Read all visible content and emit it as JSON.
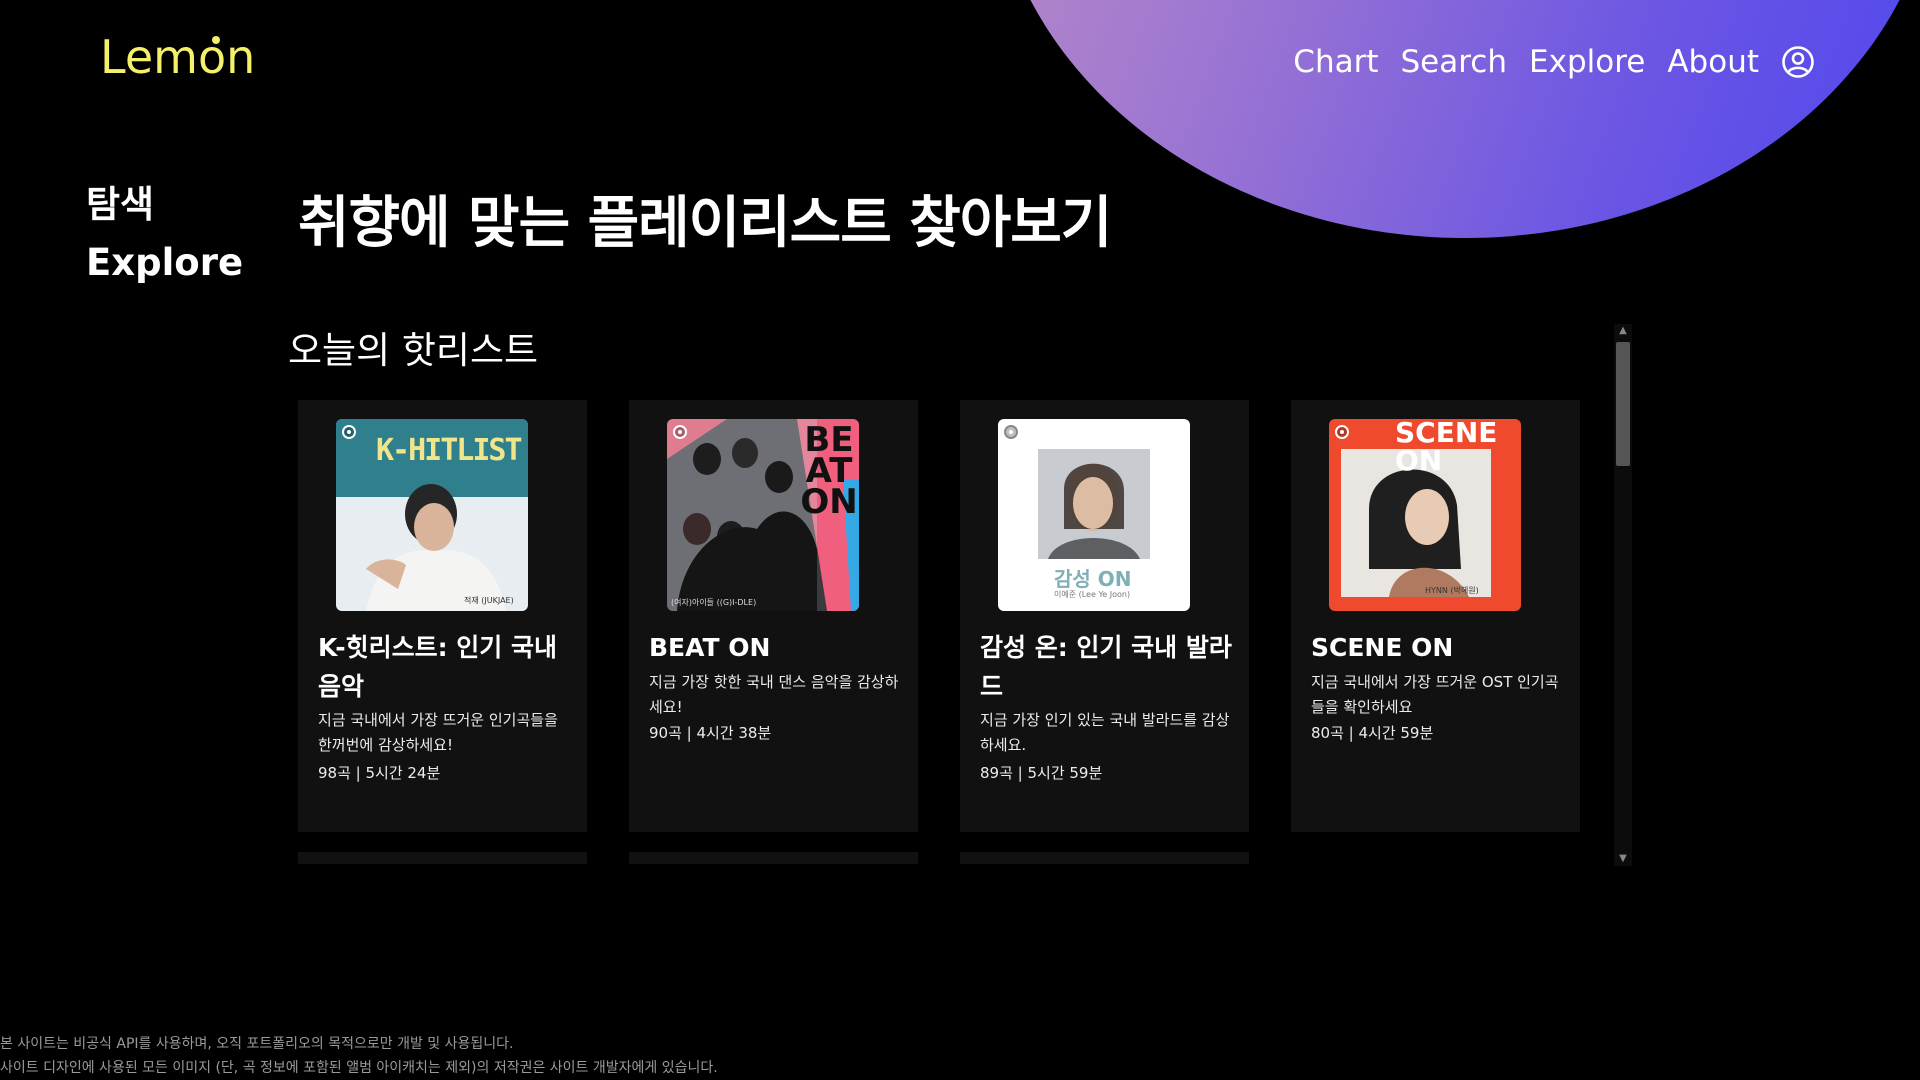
{
  "header": {
    "logo_pre": "Lem",
    "logo_o": "o",
    "logo_post": "n",
    "nav": [
      {
        "label": "Chart"
      },
      {
        "label": "Search"
      },
      {
        "label": "Explore"
      },
      {
        "label": "About"
      }
    ],
    "user_icon": "user-circle-icon"
  },
  "page": {
    "side_ko": "탐색",
    "side_en": "Explore",
    "title": "취향에 맞는 플레이리스트 찾아보기",
    "section_title": "오늘의 핫리스트"
  },
  "cards": [
    {
      "title": "K-힛리스트: 인기 국내 음악",
      "description": "지금 국내에서 가장 뜨거운 인기곡들을 한꺼번에 감상하세요!",
      "meta": "98곡 | 5시간 24분",
      "cover_text": "K-HITLIST",
      "cover_caption": "적재 (JUKJAE)",
      "cover_color": "#2f7f8c"
    },
    {
      "title": "BEAT ON",
      "description": "지금 가장 핫한 국내 댄스 음악을 감상하세요!",
      "meta": "90곡 | 4시간 38분",
      "cover_text": "BEAT ON",
      "cover_caption": "(여자)아이들 ((G)I-DLE)",
      "cover_color": "#e84f6a"
    },
    {
      "title": "감성 온: 인기 국내 발라드",
      "description": "지금 가장 인기 있는 국내 발라드를 감상하세요.",
      "meta": "89곡 | 5시간 59분",
      "cover_text": "감성 ON",
      "cover_caption": "이예준 (Lee Ye Joon)",
      "cover_color": "#ffffff"
    },
    {
      "title": "SCENE ON",
      "description": "지금 국내에서 가장 뜨거운 OST 인기곡들을 확인하세요",
      "meta": "80곡 | 4시간 59분",
      "cover_text": "SCENE ON",
      "cover_caption": "HYNN (박혜원)",
      "cover_color": "#ef4a2e"
    }
  ],
  "footer": {
    "line1": "본 사이트는 비공식 API를 사용하며, 오직 포트폴리오의 목적으로만 개발 및 사용됩니다.",
    "line2": "사이트 디자인에 사용된 모든 이미지 (단, 곡 정보에 포함된 앨범 아이캐치는 제외)의 저작권은 사이트 개발자에게 있습니다."
  }
}
